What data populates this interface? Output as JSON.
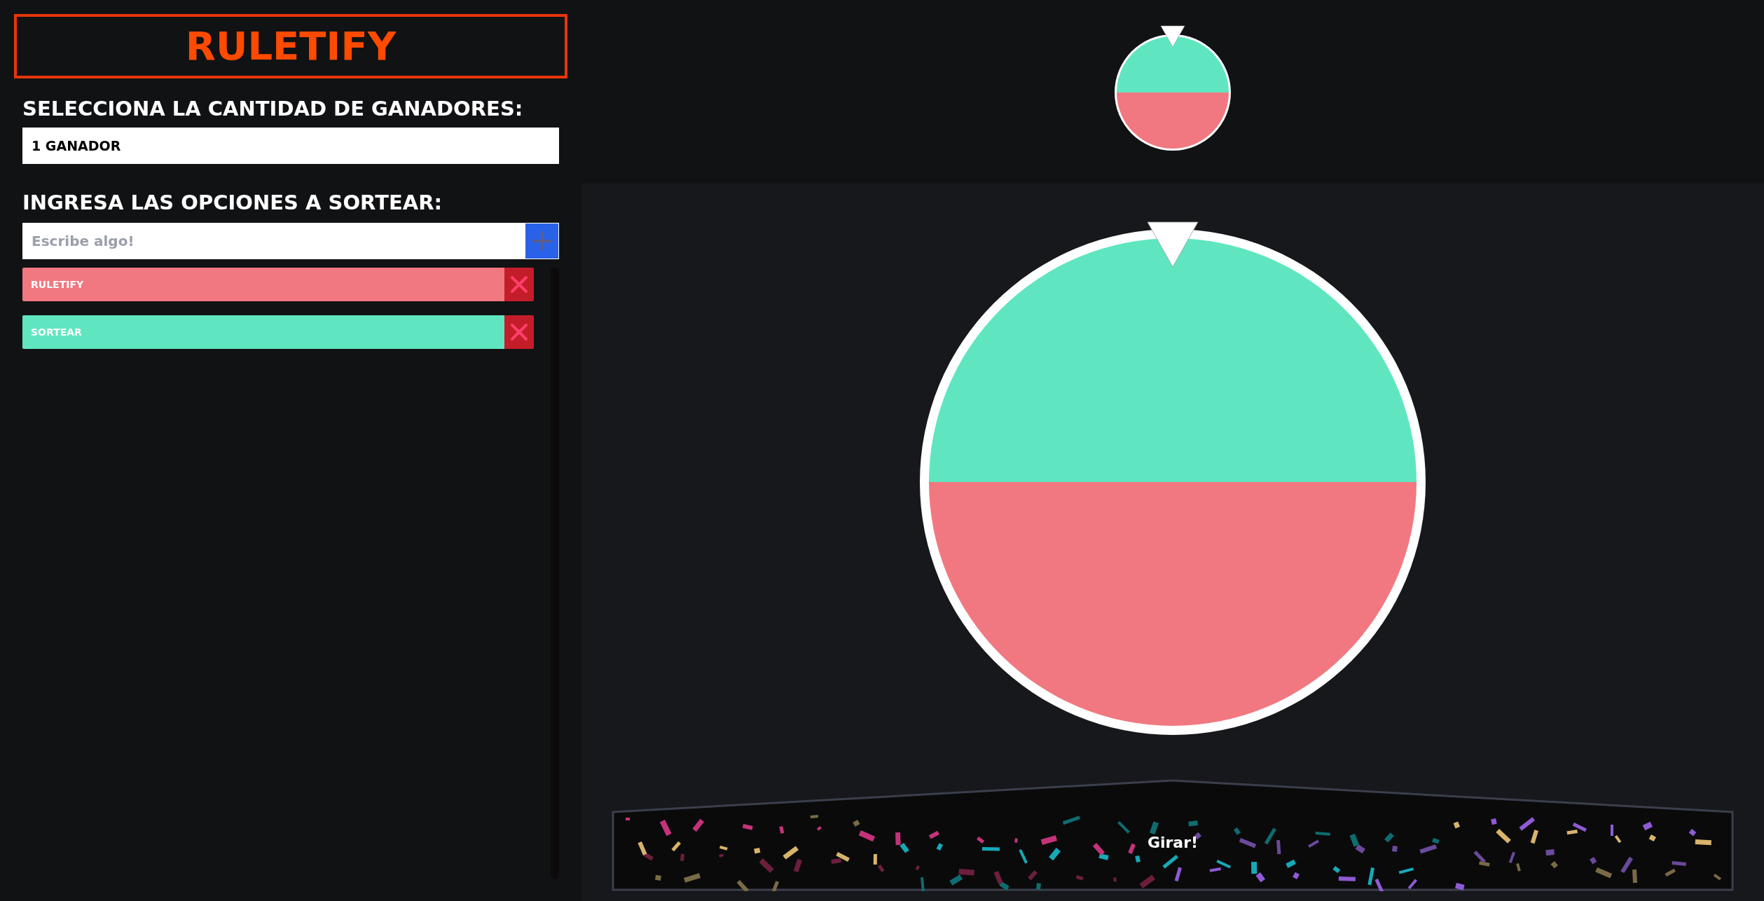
{
  "title": "RULETIFY",
  "winners": {
    "label": "SELECCIONA LA CANTIDAD DE GANADORES:",
    "value": "1 GANADOR"
  },
  "options_input": {
    "label": "INGRESA LAS OPCIONES A SORTEAR:",
    "placeholder": "Escribe algo!"
  },
  "options": [
    {
      "text": "RULETIFY",
      "color": "#f17880"
    },
    {
      "text": "SORTEAR",
      "color": "#5fe6c0"
    }
  ],
  "spin_button": "Girar!"
}
